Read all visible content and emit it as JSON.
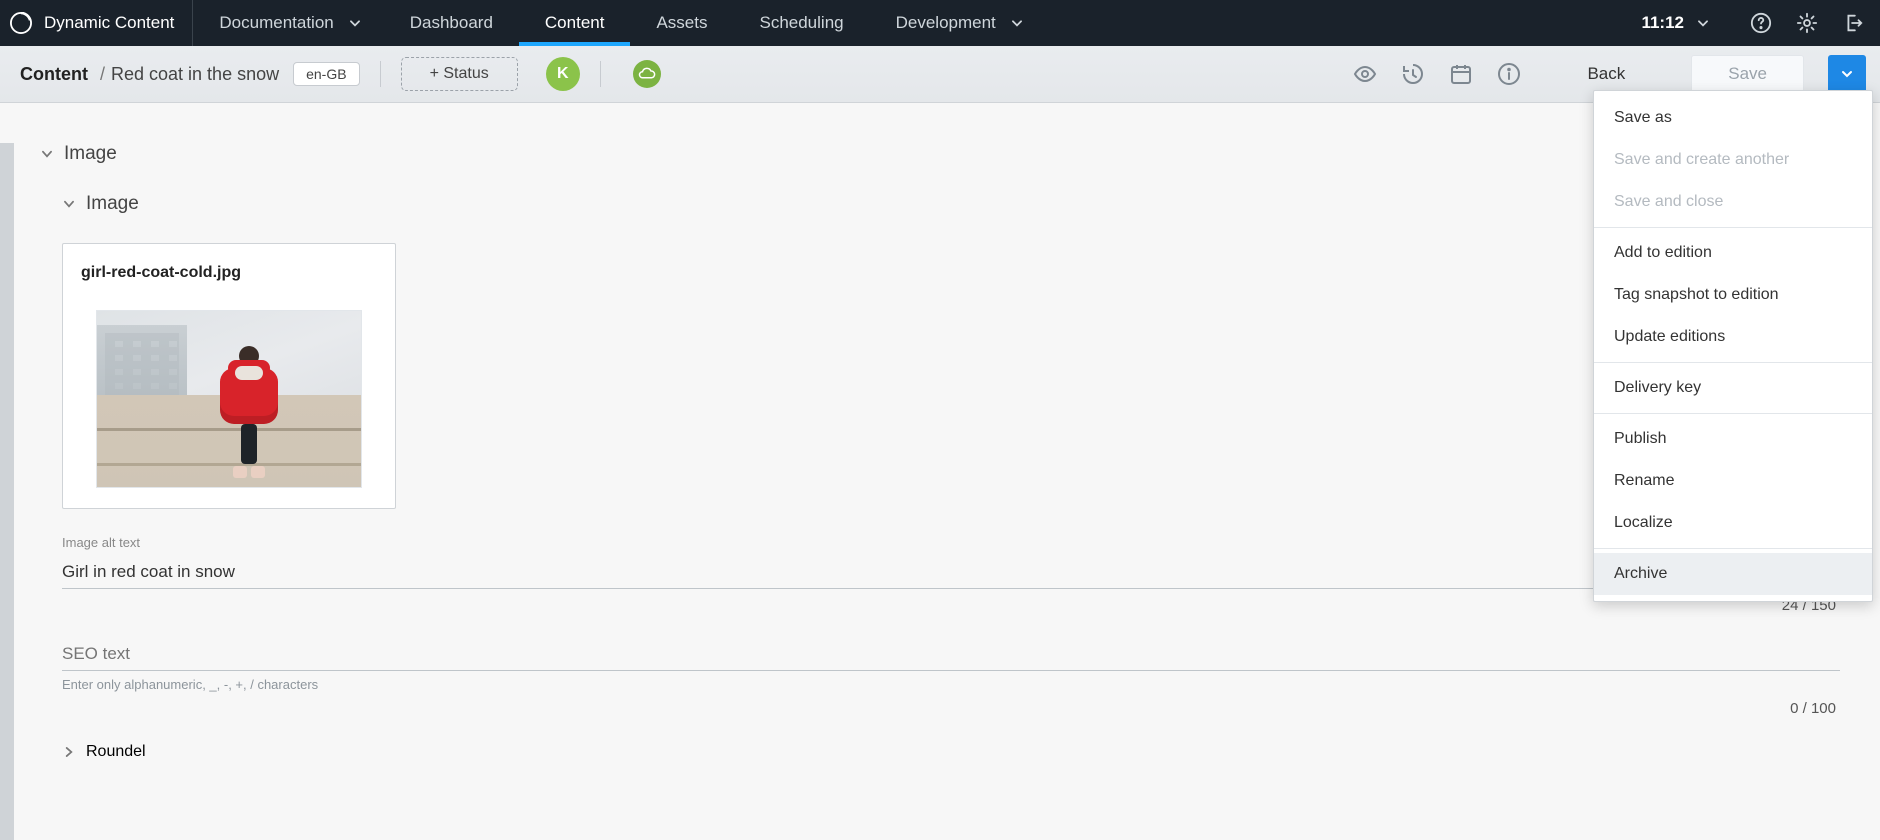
{
  "app": {
    "title": "Dynamic Content"
  },
  "topbar": {
    "doc_label": "Documentation",
    "nav": [
      "Dashboard",
      "Content",
      "Assets",
      "Scheduling",
      "Development"
    ],
    "nav_active_index": 1,
    "time": "11:12"
  },
  "subbar": {
    "root": "Content",
    "leaf": "Red coat in the snow",
    "locale": "en-GB",
    "status_btn": "+ Status",
    "avatar_initial": "K",
    "back": "Back",
    "save": "Save"
  },
  "dropdown": {
    "items": [
      {
        "label": "Save as",
        "state": "normal"
      },
      {
        "label": "Save and create another",
        "state": "disabled"
      },
      {
        "label": "Save and close",
        "state": "disabled"
      },
      {
        "sep": true
      },
      {
        "label": "Add to edition",
        "state": "normal"
      },
      {
        "label": "Tag snapshot to edition",
        "state": "normal"
      },
      {
        "label": "Update editions",
        "state": "normal"
      },
      {
        "sep": true
      },
      {
        "label": "Delivery key",
        "state": "normal"
      },
      {
        "sep": true
      },
      {
        "label": "Publish",
        "state": "normal"
      },
      {
        "label": "Rename",
        "state": "normal"
      },
      {
        "label": "Localize",
        "state": "normal"
      },
      {
        "sep": true
      },
      {
        "label": "Archive",
        "state": "hover"
      }
    ]
  },
  "form": {
    "section1": "Image",
    "section2": "Image",
    "filename": "girl-red-coat-cold.jpg",
    "alt": {
      "label": "Image alt text",
      "value": "Girl in red coat in snow",
      "counter": "24 / 150"
    },
    "seo": {
      "placeholder": "SEO text",
      "hint": "Enter only alphanumeric, _, -, +, / characters",
      "counter": "0 / 100"
    },
    "roundel_label": "Roundel"
  }
}
